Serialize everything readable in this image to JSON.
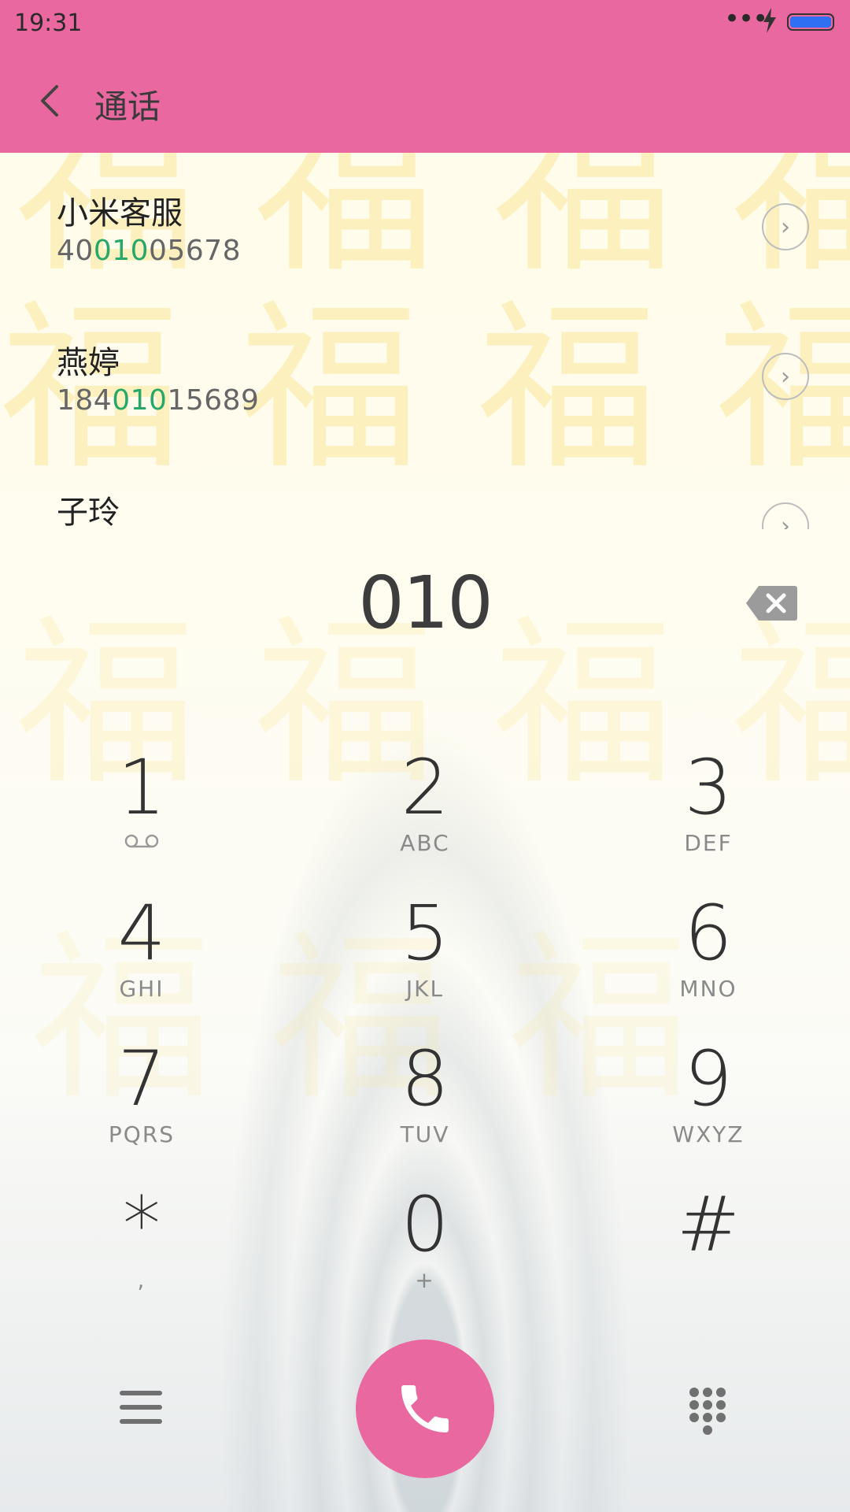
{
  "status_bar": {
    "time": "19:31",
    "dots": "•••",
    "icons": [
      "more-dots-icon",
      "charging-bolt-icon",
      "battery-icon"
    ],
    "battery_level": 1.0
  },
  "header": {
    "back_icon": "chevron-left-icon",
    "title": "通话"
  },
  "contacts": [
    {
      "name": "小米客服",
      "number_parts": [
        "40",
        "010",
        "05678"
      ],
      "detail_icon": "chevron-right-circle-icon"
    },
    {
      "name": "燕婷",
      "number_parts": [
        "184",
        "010",
        "15689"
      ],
      "detail_icon": "chevron-right-circle-icon"
    },
    {
      "name": "子玲",
      "number_parts": [],
      "detail_icon": "chevron-right-circle-icon"
    }
  ],
  "dial": {
    "input": "010",
    "backspace_icon": "backspace-icon"
  },
  "keypad": [
    {
      "digit": "1",
      "letters": "",
      "sub_icon": "voicemail-icon"
    },
    {
      "digit": "2",
      "letters": "ABC"
    },
    {
      "digit": "3",
      "letters": "DEF"
    },
    {
      "digit": "4",
      "letters": "GHI"
    },
    {
      "digit": "5",
      "letters": "JKL"
    },
    {
      "digit": "6",
      "letters": "MNO"
    },
    {
      "digit": "7",
      "letters": "PQRS"
    },
    {
      "digit": "8",
      "letters": "TUV"
    },
    {
      "digit": "9",
      "letters": "WXYZ"
    },
    {
      "digit": "*",
      "letters": ","
    },
    {
      "digit": "0",
      "letters": "+"
    },
    {
      "digit": "#",
      "letters": ""
    }
  ],
  "bottom_bar": {
    "menu_icon": "menu-icon",
    "call_icon": "phone-icon",
    "dialpad_icon": "dialpad-icon"
  },
  "colors": {
    "accent": "#ea68a0",
    "highlight": "#27a86a",
    "wallpaper_glyphs": "#fbe79a"
  }
}
